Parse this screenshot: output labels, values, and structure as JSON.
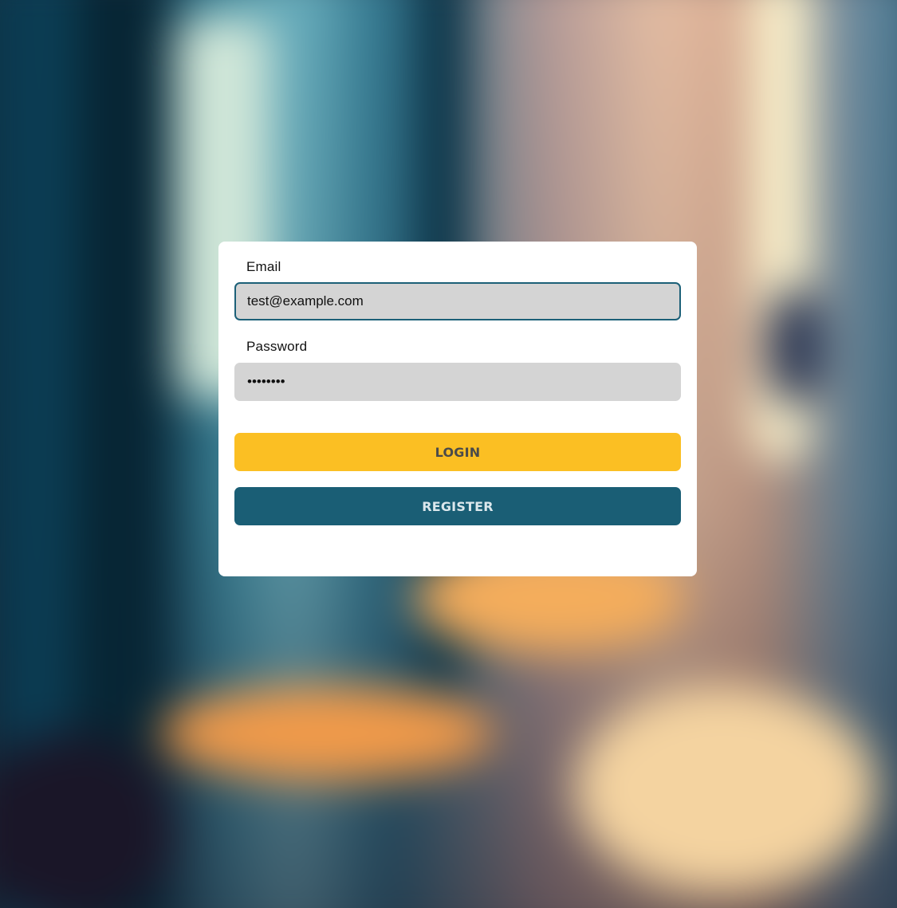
{
  "login_form": {
    "email_label": "Email",
    "email_value": "test@example.com",
    "password_label": "Password",
    "password_value": "password",
    "login_button": "LOGIN",
    "register_button": "REGISTER"
  },
  "colors": {
    "login_button_bg": "#fbbf23",
    "register_button_bg": "#1a5e75",
    "input_bg": "#d4d4d4",
    "focus_border": "#1c6078",
    "card_bg": "#ffffff"
  }
}
